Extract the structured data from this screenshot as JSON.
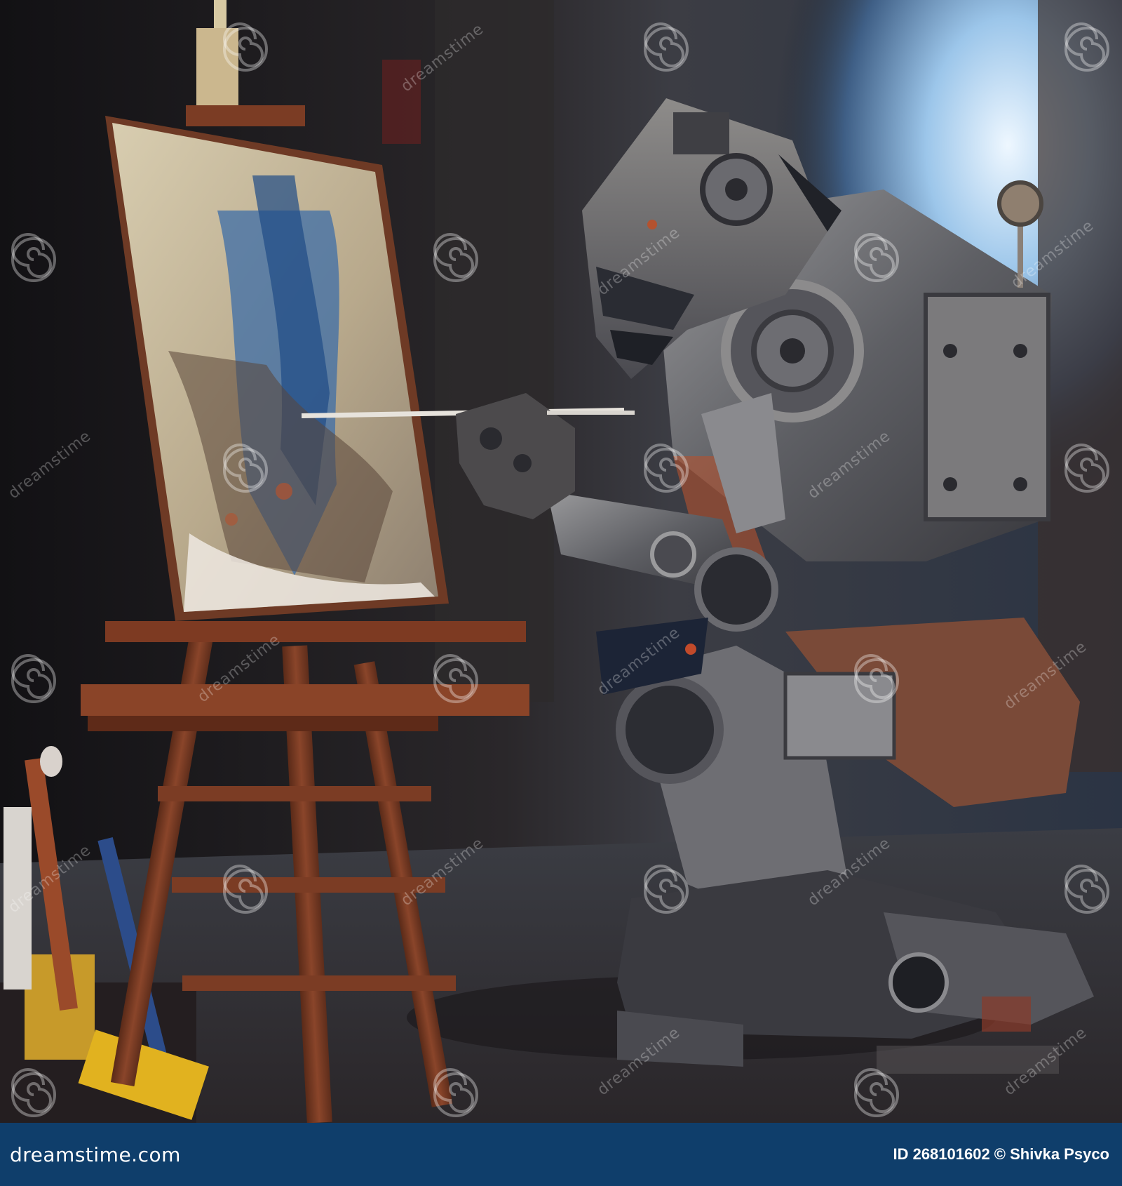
{
  "image": {
    "subject": "robot painting at easel",
    "palette": {
      "wall_dark": "#17161a",
      "window_glow": "#cfe6f7",
      "sky_blue": "#5b8fc0",
      "wood": "#7a3b22",
      "robot_metal": "#6f7176",
      "rust": "#b4522f",
      "floor": "#4a4648"
    }
  },
  "watermark": {
    "text": "dreamstime",
    "icon": "spiral-icon"
  },
  "footer": {
    "background": "#0f3e6b",
    "logo_text": "dreamstime.com",
    "credit_text": "ID 268101602 © Shivka Psyco"
  }
}
